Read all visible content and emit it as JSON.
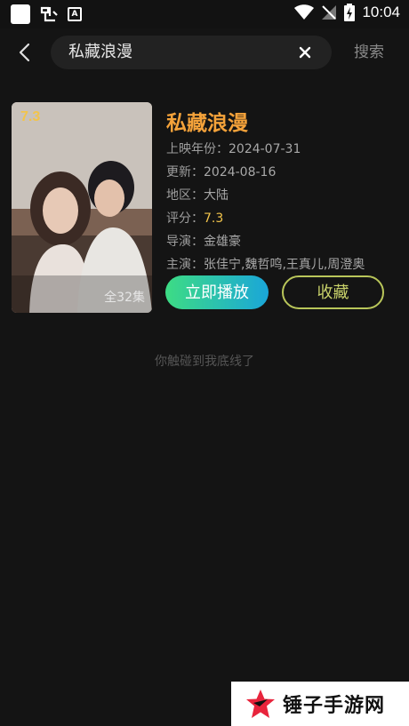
{
  "status_bar": {
    "time": "10:04",
    "a_icon": "A"
  },
  "search": {
    "query": "私藏浪漫",
    "placeholder": "",
    "search_label": "搜索"
  },
  "result": {
    "title": "私藏浪漫",
    "poster_score": "7.3",
    "poster_episodes": "全32集",
    "year_label": "上映年份：",
    "year": "2024-07-31",
    "update_label": "更新：",
    "update": "2024-08-16",
    "region_label": "地区：",
    "region": "大陆",
    "score_label": "评分：",
    "score": "7.3",
    "director_label": "导演：",
    "director": "金雄豪",
    "cast_label": "主演：",
    "cast": "张佳宁,魏哲鸣,王真儿,周澄奥",
    "play_label": "立即播放",
    "fav_label": "收藏"
  },
  "end_message": "你触碰到我底线了",
  "watermark": {
    "text": "锤子手游网"
  },
  "colors": {
    "accent_title": "#f4a23a",
    "score": "#f2c44b",
    "play_from": "#3ddc84",
    "play_to": "#1aa6d9",
    "fav_border": "#b9c65a"
  }
}
